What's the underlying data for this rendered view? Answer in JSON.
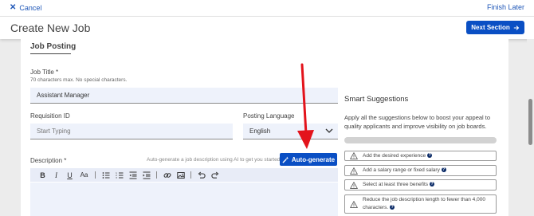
{
  "topbar": {
    "cancel_label": "Cancel",
    "finish_later_label": "Finish Later"
  },
  "header": {
    "title": "Create New Job",
    "next_label": "Next Section"
  },
  "form": {
    "section_title": "Job Posting",
    "job_title_label": "Job Title *",
    "job_title_hint": "70 characters max. No special characters.",
    "job_title_value": "Assistant Manager",
    "requisition_label": "Requisition ID",
    "requisition_placeholder": "Start Typing",
    "posting_language_label": "Posting Language",
    "posting_language_value": "English",
    "description_label": "Description *",
    "ai_hint": "Auto-generate a job description using AI to get you started",
    "autogenerate_label": "Auto-generate",
    "toolbar": [
      "B",
      "I",
      "U",
      "Aa",
      "bulleted-list",
      "numbered-list",
      "outdent",
      "indent",
      "link",
      "image",
      "undo",
      "redo"
    ]
  },
  "smart": {
    "title": "Smart Suggestions",
    "description": "Apply all the suggestions below to boost your appeal to quality applicants and improve visibility on job boards.",
    "progress": 0,
    "items": [
      "Add the desired experience",
      "Add a salary range or fixed salary",
      "Select at least three benefits",
      "Reduce the job description length to fewer than 4,000 characters."
    ]
  },
  "colors": {
    "primary": "#0a4fc4",
    "annotation_arrow": "#e3131b"
  }
}
